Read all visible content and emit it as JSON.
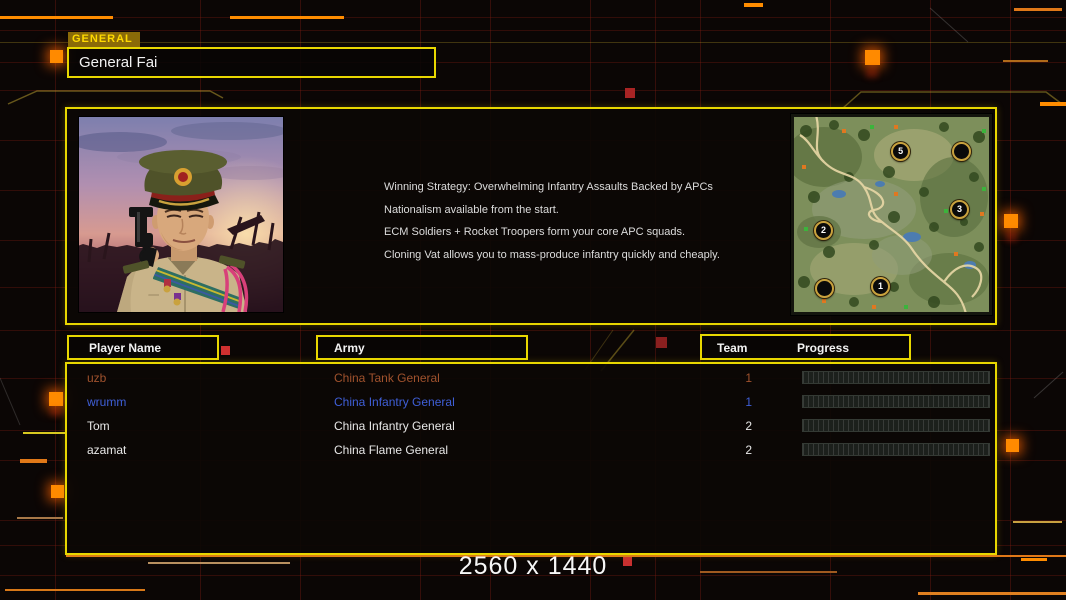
{
  "header": {
    "tab_label": "GENERAL",
    "general_name": "General Fai"
  },
  "strategy": {
    "lines": [
      "Winning Strategy: Overwhelming Infantry Assaults Backed by APCs",
      "Nationalism available from the start.",
      "ECM Soldiers + Rocket Troopers form your core APC squads.",
      "Cloning Vat allows you to mass-produce infantry quickly and cheaply."
    ]
  },
  "map": {
    "markers": [
      {
        "label": "5",
        "x": 54.4,
        "y": 17.4
      },
      {
        "label": "",
        "x": 85.6,
        "y": 17.4
      },
      {
        "label": "3",
        "x": 84.6,
        "y": 47.2
      },
      {
        "label": "2",
        "x": 14.9,
        "y": 57.9
      },
      {
        "label": "1",
        "x": 44.1,
        "y": 86.7
      },
      {
        "label": "",
        "x": 15.4,
        "y": 87.7
      }
    ]
  },
  "table": {
    "player_header": "Player Name",
    "army_header": "Army",
    "team_header": "Team",
    "progress_header": "Progress",
    "rows": [
      {
        "name": "uzb",
        "army": "China Tank General",
        "team": "1",
        "color": "#a0522d",
        "progress": 0
      },
      {
        "name": "wrumm",
        "army": "China Infantry General",
        "team": "1",
        "color": "#3f5fd8",
        "progress": 0
      },
      {
        "name": "Tom",
        "army": "China Infantry General",
        "team": "2",
        "color": "#e8e8e8",
        "progress": 0
      },
      {
        "name": "azamat",
        "army": "China Flame General",
        "team": "2",
        "color": "#e8e8e8",
        "progress": 0
      }
    ]
  },
  "footer": {
    "resolution": "2560 x 1440"
  },
  "colors": {
    "accent_yellow": "#e8d700",
    "accent_orange": "#ff8a00",
    "tab_background": "#8a6a08",
    "player_orange": "#a0522d",
    "player_blue": "#3f5fd8",
    "player_white": "#e8e8e8",
    "grid_red": "#7d1c12"
  }
}
